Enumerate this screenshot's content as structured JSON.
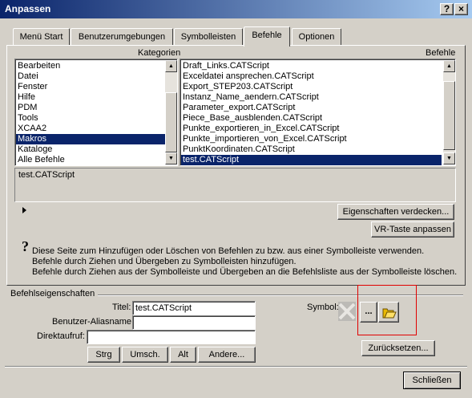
{
  "window": {
    "title": "Anpassen",
    "help_button": "?",
    "close_button": "×"
  },
  "tabs": [
    {
      "label": "Menü Start",
      "active": false
    },
    {
      "label": "Benutzerumgebungen",
      "active": false
    },
    {
      "label": "Symbolleisten",
      "active": false
    },
    {
      "label": "Befehle",
      "active": true
    },
    {
      "label": "Optionen",
      "active": false
    }
  ],
  "categories": {
    "header": "Kategorien",
    "items": [
      "Bearbeiten",
      "Datei",
      "Fenster",
      "Hilfe",
      "PDM",
      "Tools",
      "XCAA2",
      "Makros",
      "Kataloge",
      "Alle Befehle"
    ],
    "selected": "Makros"
  },
  "commands": {
    "header": "Befehle",
    "items": [
      "Draft_Links.CATScript",
      "Exceldatei ansprechen.CATScript",
      "Export_STEP203.CATScript",
      "Instanz_Name_aendern.CATScript",
      "Parameter_export.CATScript",
      "Piece_Base_ausblenden.CATScript",
      "Punkte_exportieren_in_Excel.CATScript",
      "Punkte_importieren_von_Excel.CATScript",
      "PunktKoordinaten.CATScript",
      "test.CATScript"
    ],
    "selected": "test.CATScript"
  },
  "description": {
    "text": "test.CATScript"
  },
  "buttons": {
    "hide_properties": "Eigenschaften verdecken...",
    "vr_key": "VR-Taste anpassen",
    "reset": "Zurücksetzen...",
    "close": "Schließen",
    "browse": "..."
  },
  "help": {
    "icon": "?",
    "line1": "Diese Seite zum Hinzufügen oder Löschen von Befehlen zu bzw. aus einer Symbolleiste verwenden.",
    "line2": "Befehle durch Ziehen und Übergeben zu Symbolleisten hinzufügen.",
    "line3": "Befehle durch Ziehen aus der Symbolleiste und Übergeben an die Befehlsliste aus der Symbolleiste löschen."
  },
  "properties": {
    "group_label": "Befehlseigenschaften",
    "title_label": "Titel:",
    "title_value": "test.CATScript",
    "alias_label": "Benutzer-Aliasname:",
    "alias_value": "",
    "shortcut_label": "Direktaufruf:",
    "shortcut_value": "",
    "symbol_label": "Symbol:",
    "modifiers": [
      "Strg",
      "Umsch.",
      "Alt",
      "Andere..."
    ]
  },
  "colors": {
    "selection": "#0a246a",
    "highlight_box": "#e00000",
    "folder_icon": "#e8b800"
  }
}
